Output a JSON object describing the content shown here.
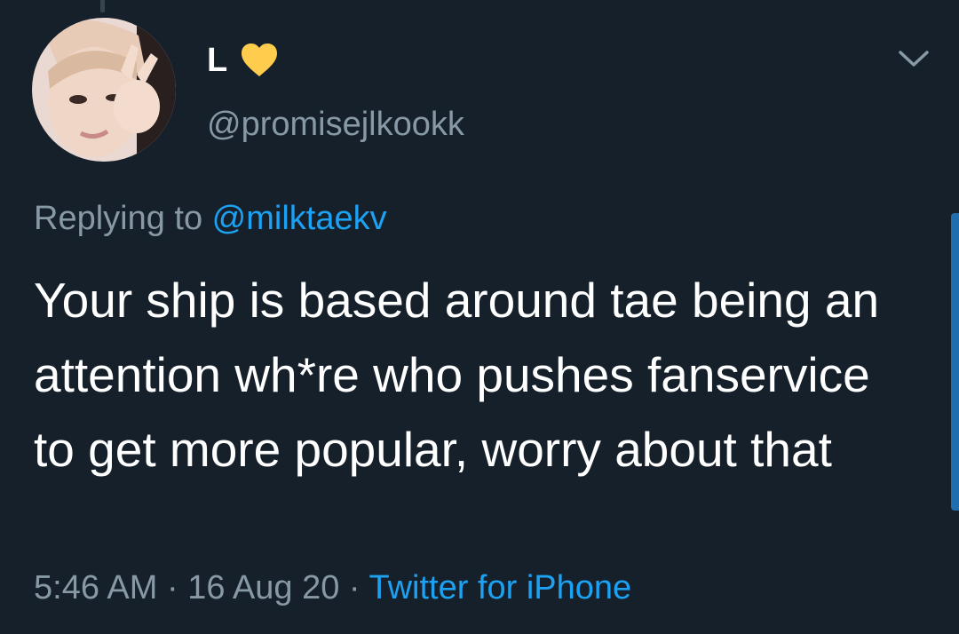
{
  "author": {
    "display_name": "L",
    "name_emoji": "yellow-heart-icon",
    "handle": "@promisejlkookk"
  },
  "reply": {
    "prefix": "Replying to ",
    "mention": "@milktaekv"
  },
  "tweet": {
    "text": "Your ship is based around tae being an attention wh*re who pushes fanservice to get more popular, worry about that"
  },
  "meta": {
    "time": "5:46 AM",
    "separator1": " · ",
    "date": "16 Aug 20",
    "separator2": " · ",
    "source": "Twitter for iPhone"
  },
  "colors": {
    "background": "#15202b",
    "primary_text": "#ffffff",
    "secondary_text": "#8899a6",
    "link": "#1da1f2",
    "heart": "#ffcc4d"
  }
}
